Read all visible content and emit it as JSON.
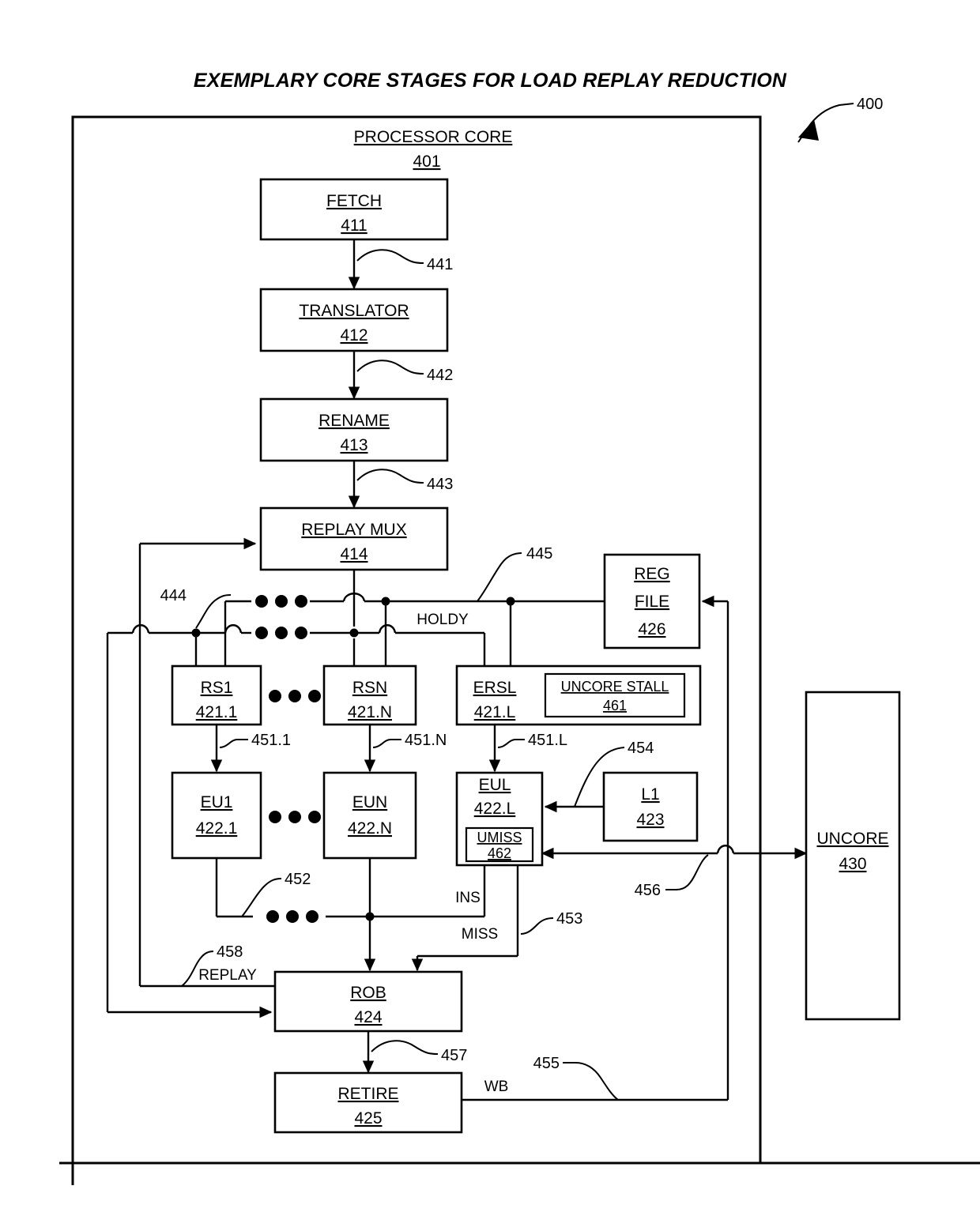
{
  "figure": {
    "title": "EXEMPLARY CORE STAGES FOR LOAD REPLAY REDUCTION",
    "figure_ref": "400"
  },
  "core": {
    "label": "PROCESSOR CORE",
    "number": "401"
  },
  "blocks": {
    "fetch": {
      "label": "FETCH",
      "number": "411"
    },
    "translator": {
      "label": "TRANSLATOR",
      "number": "412"
    },
    "rename": {
      "label": "RENAME",
      "number": "413"
    },
    "replay_mux": {
      "label": "REPLAY MUX",
      "number": "414"
    },
    "rs1": {
      "label": "RS1",
      "number": "421.1"
    },
    "rsn": {
      "label": "RSN",
      "number": "421.N"
    },
    "ersl": {
      "label": "ERSL",
      "number": "421.L"
    },
    "uncore_stall": {
      "label": "UNCORE STALL",
      "number": "461"
    },
    "eu1": {
      "label": "EU1",
      "number": "422.1"
    },
    "eun": {
      "label": "EUN",
      "number": "422.N"
    },
    "eul": {
      "label": "EUL",
      "number": "422.L"
    },
    "umiss": {
      "label": "UMISS",
      "number": "462"
    },
    "l1": {
      "label": "L1",
      "number": "423"
    },
    "reg_file": {
      "label": "REG",
      "label2": "FILE",
      "number": "426"
    },
    "rob": {
      "label": "ROB",
      "number": "424"
    },
    "retire": {
      "label": "RETIRE",
      "number": "425"
    },
    "uncore": {
      "label": "UNCORE",
      "number": "430"
    }
  },
  "refs": {
    "r441": "441",
    "r442": "442",
    "r443": "443",
    "r444": "444",
    "r445": "445",
    "r451_1": "451.1",
    "r451_n": "451.N",
    "r451_l": "451.L",
    "r452": "452",
    "r453": "453",
    "r454": "454",
    "r455": "455",
    "r456": "456",
    "r457": "457",
    "r458": "458"
  },
  "signals": {
    "holdy": "HOLDY",
    "ins": "INS",
    "miss": "MISS",
    "replay": "REPLAY",
    "wb": "WB"
  },
  "colors": {
    "stroke": "#000000",
    "fill": "#ffffff"
  }
}
